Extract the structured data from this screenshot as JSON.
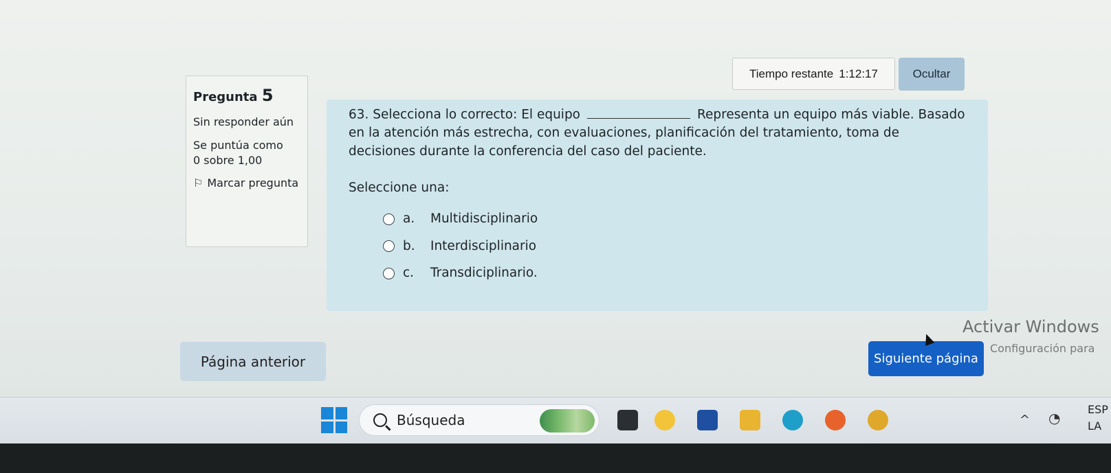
{
  "timer": {
    "label": "Tiempo restante",
    "value": "1:12:17"
  },
  "hide_button": "Ocultar",
  "question_info": {
    "title_word": "Pregunta",
    "number": "5",
    "status": "Sin responder aún",
    "score_label": "Se puntúa como",
    "score_value": "0 sobre 1,00",
    "flag_label": "Marcar pregunta"
  },
  "question": {
    "part1": "63. Selecciona lo correcto: El equipo",
    "part2": "Representa un equipo más viable. Basado en la atención más estrecha, con evaluaciones, planificación del tratamiento, toma de decisiones durante la conferencia del caso del paciente.",
    "prompt": "Seleccione una:",
    "options": [
      {
        "letter": "a.",
        "text": "Multidisciplinario"
      },
      {
        "letter": "b.",
        "text": "Interdisciplinario"
      },
      {
        "letter": "c.",
        "text": "Transdiciplinario."
      }
    ]
  },
  "navigation": {
    "prev": "Página anterior",
    "next": "Siguiente página"
  },
  "watermark": {
    "title": "Activar Windows",
    "subtitle": "Configuración para"
  },
  "taskbar": {
    "search_placeholder": "Búsqueda",
    "tray_lang_1": "ESP",
    "tray_lang_2": "LA"
  }
}
